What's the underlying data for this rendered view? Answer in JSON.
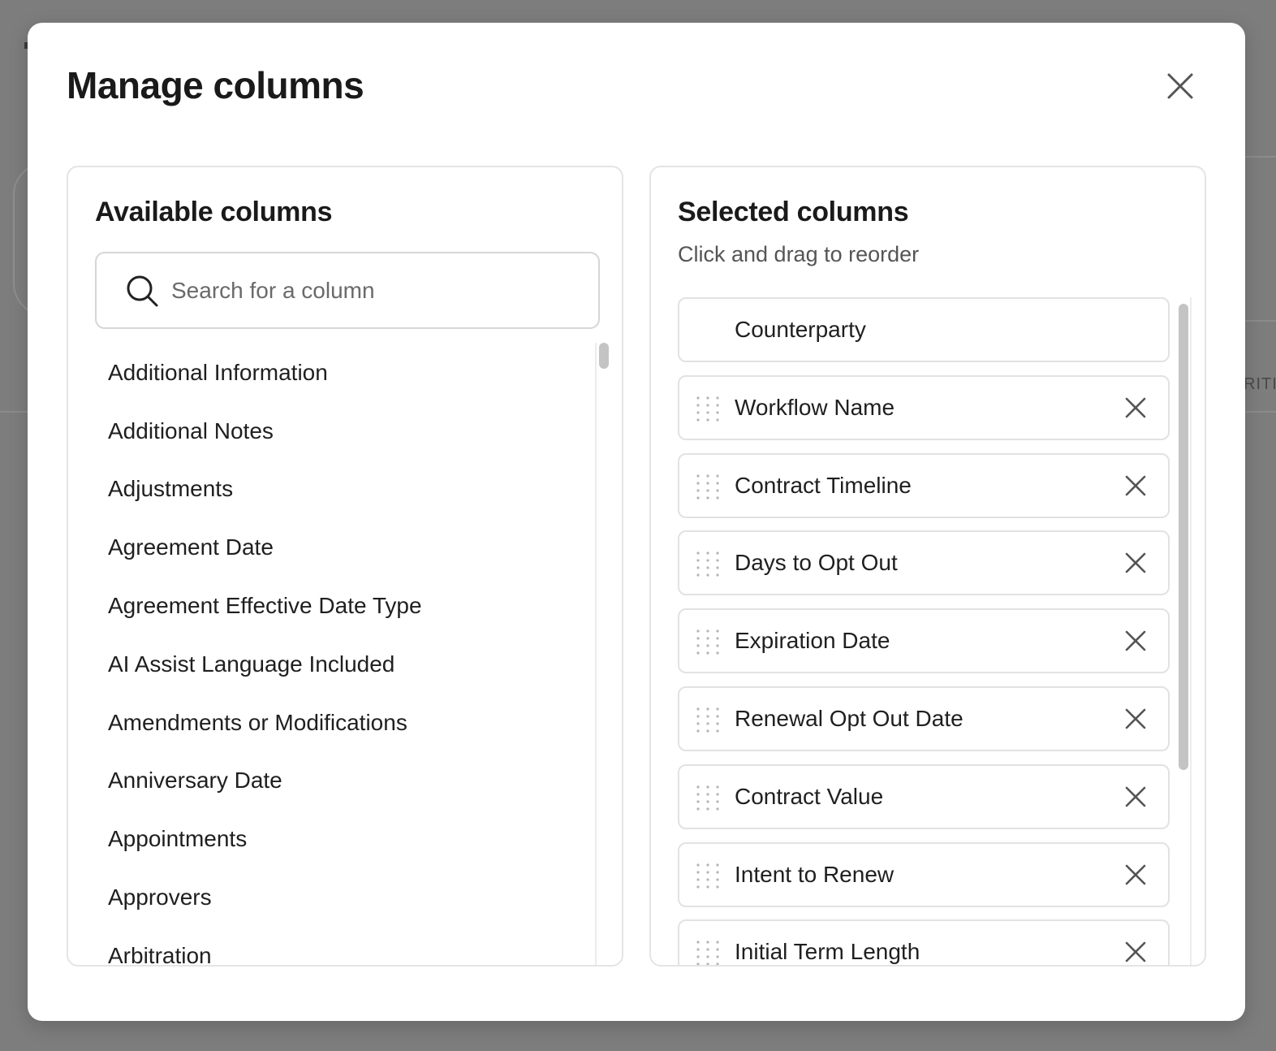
{
  "background": {
    "partial_text": "RITI"
  },
  "modal": {
    "title": "Manage columns"
  },
  "available": {
    "title": "Available columns",
    "search_placeholder": "Search for a column",
    "search_value": "",
    "items": [
      "Additional Information",
      "Additional Notes",
      "Adjustments",
      "Agreement Date",
      "Agreement Effective Date Type",
      "AI Assist Language Included",
      "Amendments or Modifications",
      "Anniversary Date",
      "Appointments",
      "Approvers",
      "Arbitration"
    ]
  },
  "selected": {
    "title": "Selected columns",
    "subtitle": "Click and drag to reorder",
    "items": [
      {
        "label": "Counterparty",
        "locked": true
      },
      {
        "label": "Workflow Name",
        "locked": false
      },
      {
        "label": "Contract Timeline",
        "locked": false
      },
      {
        "label": "Days to Opt Out",
        "locked": false
      },
      {
        "label": "Expiration Date",
        "locked": false
      },
      {
        "label": "Renewal Opt Out Date",
        "locked": false
      },
      {
        "label": "Contract Value",
        "locked": false
      },
      {
        "label": "Intent to Renew",
        "locked": false
      },
      {
        "label": "Initial Term Length",
        "locked": false
      }
    ]
  },
  "icons": {
    "close": "close-icon",
    "search": "search-icon",
    "drag": "drag-handle-icon",
    "remove": "remove-icon"
  },
  "colors": {
    "overlay": "#7d7d7d",
    "modal_bg": "#ffffff",
    "border": "#e2e2e2",
    "text_primary": "#1f1f1f",
    "text_secondary": "#555555",
    "scrollbar": "#c4c4c4"
  }
}
